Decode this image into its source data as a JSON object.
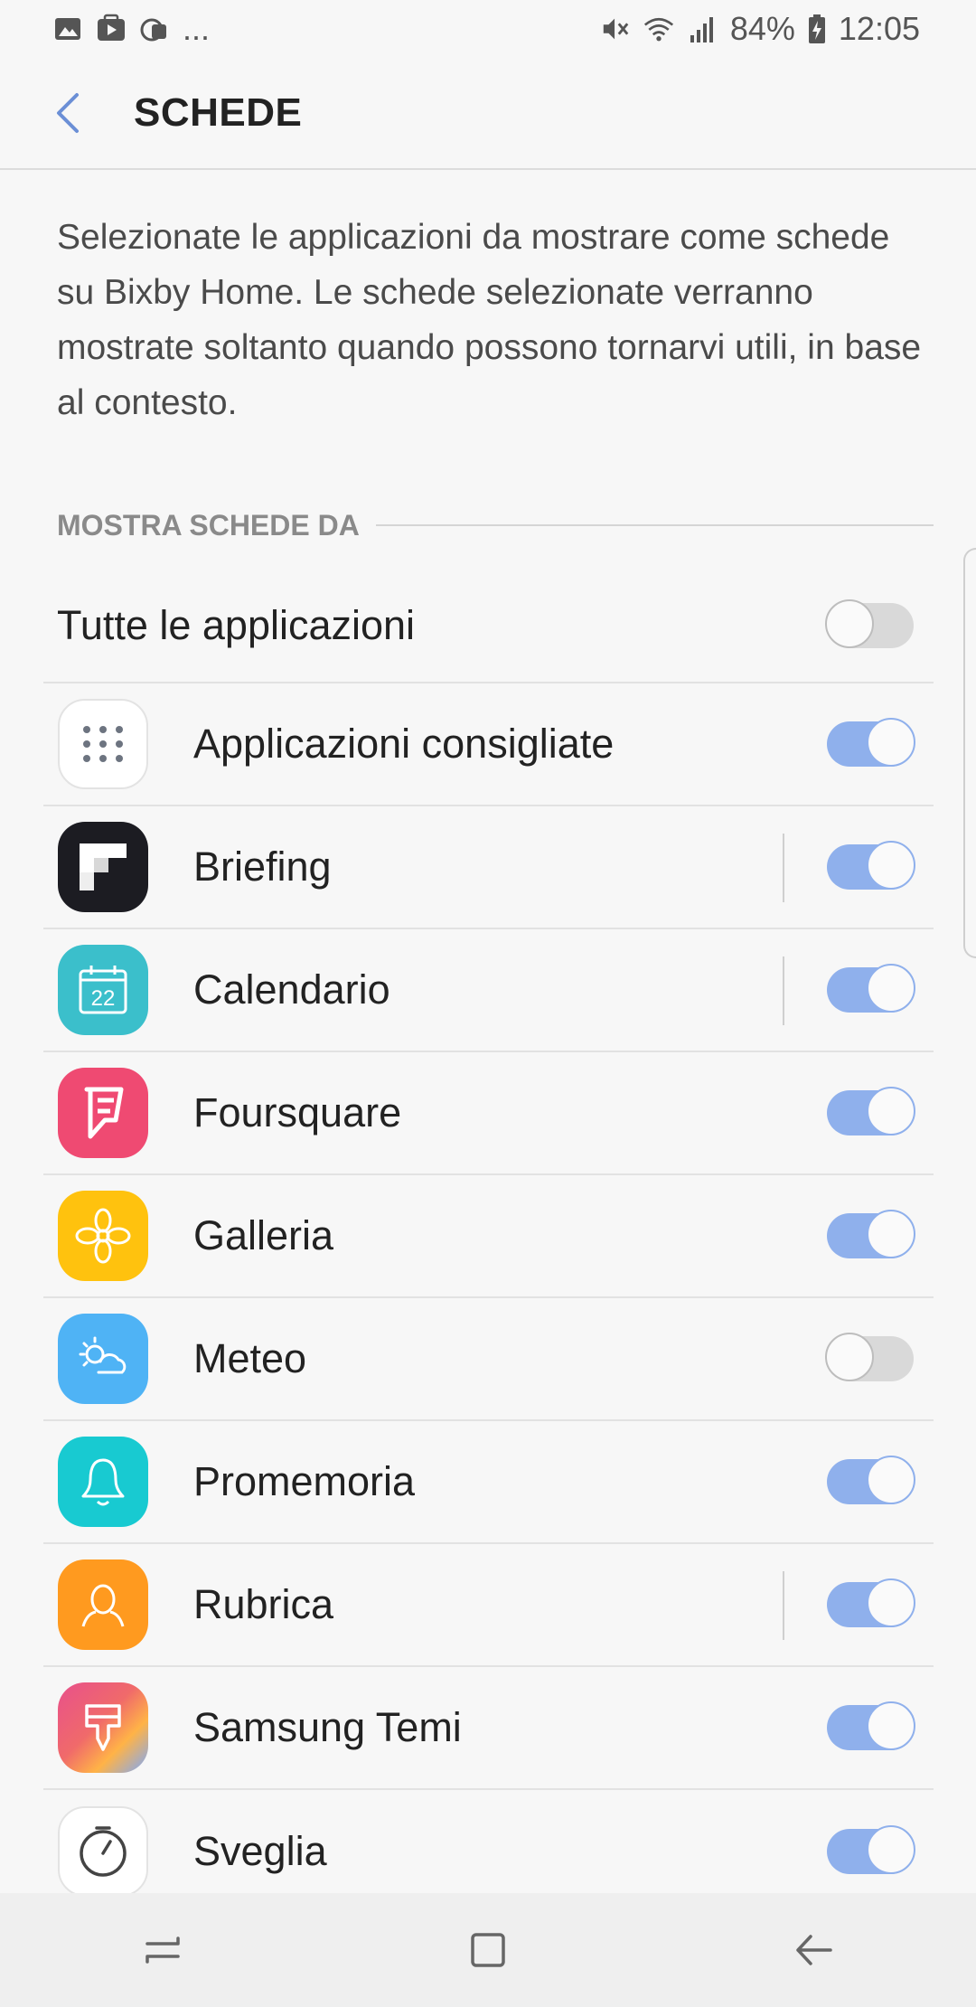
{
  "status_bar": {
    "left_icons": [
      "image-icon",
      "play-store-icon",
      "cloud-sync-icon"
    ],
    "more": "...",
    "battery": "84%",
    "time": "12:05"
  },
  "header": {
    "title": "SCHEDE"
  },
  "description": "Selezionate le applicazioni da mostrare come schede su Bixby Home. Le schede selezionate verranno mostrate soltanto quando possono tornarvi utili, in base al contesto.",
  "section": {
    "label": "MOSTRA SCHEDE DA"
  },
  "all_apps": {
    "label": "Tutte le applicazioni",
    "enabled": false
  },
  "apps": [
    {
      "label": "Applicazioni consigliate",
      "icon": "apps-grid-icon",
      "enabled": true,
      "has_settings": false,
      "color": "#ffffff"
    },
    {
      "label": "Briefing",
      "icon": "briefing-icon",
      "enabled": true,
      "has_settings": true,
      "color": "#1c1c22"
    },
    {
      "label": "Calendario",
      "icon": "calendar-icon",
      "enabled": true,
      "has_settings": true,
      "color": "#3bbfcb",
      "day": "22"
    },
    {
      "label": "Foursquare",
      "icon": "foursquare-icon",
      "enabled": true,
      "has_settings": false,
      "color": "#ef4a72"
    },
    {
      "label": "Galleria",
      "icon": "gallery-flower-icon",
      "enabled": true,
      "has_settings": false,
      "color": "#ffc20e"
    },
    {
      "label": "Meteo",
      "icon": "weather-icon",
      "enabled": false,
      "has_settings": false,
      "color": "#4fb3f5"
    },
    {
      "label": "Promemoria",
      "icon": "reminder-bell-icon",
      "enabled": true,
      "has_settings": false,
      "color": "#18cad1"
    },
    {
      "label": "Rubrica",
      "icon": "contacts-icon",
      "enabled": true,
      "has_settings": true,
      "color": "#ff9a1f"
    },
    {
      "label": "Samsung Temi",
      "icon": "themes-brush-icon",
      "enabled": true,
      "has_settings": false,
      "color": "#e8508c"
    },
    {
      "label": "Sveglia",
      "icon": "alarm-clock-icon",
      "enabled": true,
      "has_settings": false,
      "color": "#ffffff"
    }
  ],
  "colors": {
    "toggle_on": "#8fb0ec",
    "toggle_off": "#d9d9d9",
    "accent_back": "#6b8fd6"
  },
  "nav_bar": {
    "buttons": [
      "recents-icon",
      "home-icon",
      "back-arrow-icon"
    ]
  }
}
